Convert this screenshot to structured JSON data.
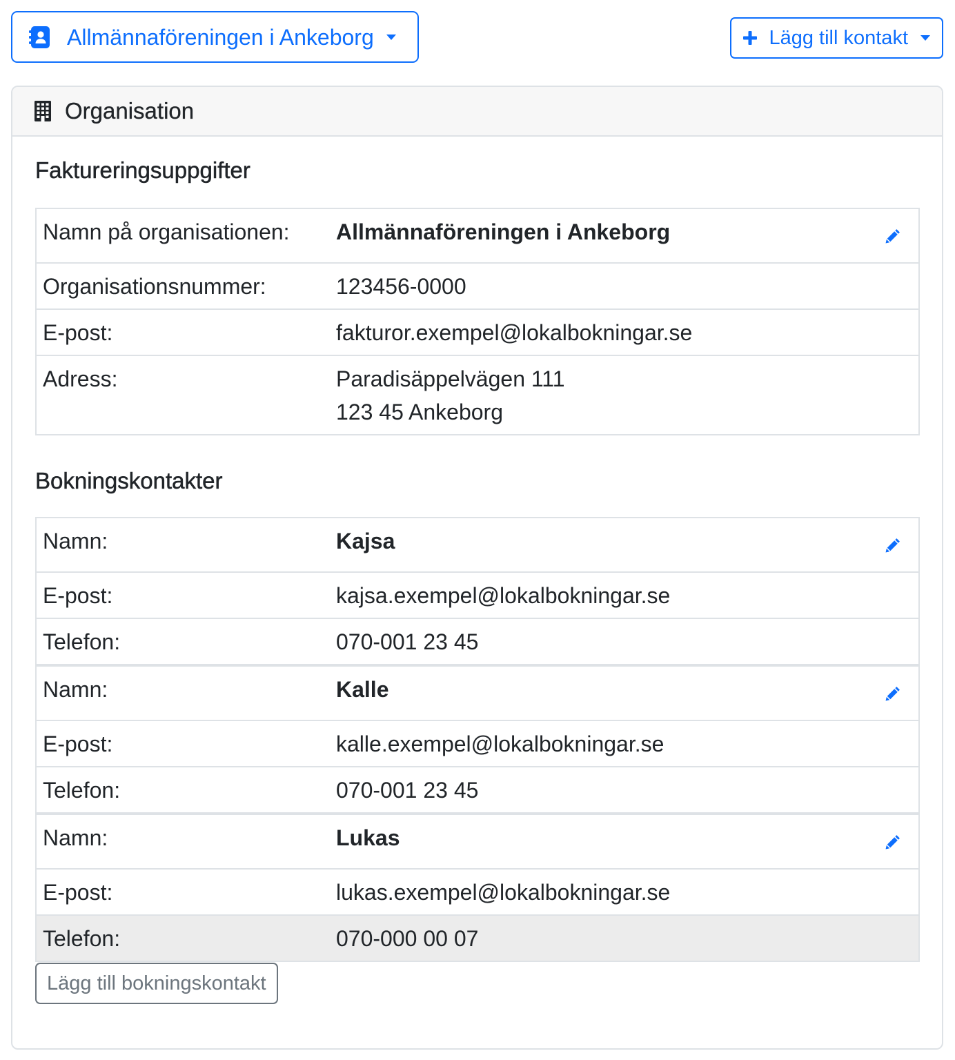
{
  "colors": {
    "primary": "#0d6efd",
    "text": "#212529",
    "border": "#dee2e6",
    "card_header_bg": "#f7f7f7",
    "secondary": "#6c757d",
    "row_hover_bg": "#ececec"
  },
  "toolbar": {
    "organization_selector": {
      "icon": "address-book-icon",
      "label": "Allmännaföreningen i Ankeborg",
      "caret_icon": "caret-down-icon"
    },
    "add_contact_menu": {
      "icon": "plus-icon",
      "label": "Lägg till kontakt",
      "caret_icon": "caret-down-icon"
    }
  },
  "organisation_card": {
    "icon": "building-icon",
    "title": "Organisation",
    "billing": {
      "heading": "Faktureringsuppgifter",
      "edit_icon": "pencil-icon",
      "name_label": "Namn på organisationen:",
      "name": "Allmännaföreningen i Ankeborg",
      "org_number_label": "Organisationsnummer:",
      "org_number": "123456-0000",
      "email_label": "E-post:",
      "email": "fakturor.exempel@lokalbokningar.se",
      "address_label": "Adress:",
      "address_lines": [
        "Paradisäppelvägen 111",
        "123 45 Ankeborg"
      ]
    },
    "booking_contacts": {
      "heading": "Bokningskontakter",
      "edit_icon": "pencil-icon",
      "contacts": [
        {
          "name_label": "Namn:",
          "name": "Kajsa",
          "email_label": "E-post:",
          "email": "kajsa.exempel@lokalbokningar.se",
          "phone_label": "Telefon:",
          "phone": "070-001 23 45"
        },
        {
          "name_label": "Namn:",
          "name": "Kalle",
          "email_label": "E-post:",
          "email": "kalle.exempel@lokalbokningar.se",
          "phone_label": "Telefon:",
          "phone": "070-001 23 45"
        },
        {
          "name_label": "Namn:",
          "name": "Lukas",
          "email_label": "E-post:",
          "email": "lukas.exempel@lokalbokningar.se",
          "phone_label": "Telefon:",
          "phone": "070-000 00 07"
        }
      ],
      "add_button_label": "Lägg till bokningskontakt"
    }
  }
}
